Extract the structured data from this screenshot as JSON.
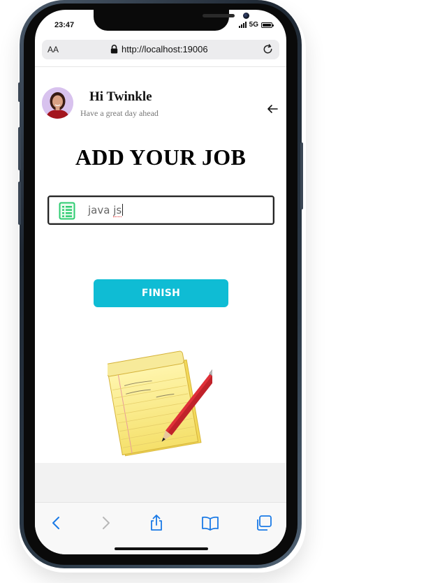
{
  "status_bar": {
    "time": "23:47",
    "network": "5G",
    "signal_icon": "cellular-signal-icon",
    "battery_icon": "battery-icon"
  },
  "browser": {
    "text_size_label": "AA",
    "url": "http://localhost:19006",
    "lock_icon": "lock-icon",
    "reload_icon": "reload-icon"
  },
  "header": {
    "greeting": "Hi Twinkle",
    "subtitle": "Have a great day ahead",
    "avatar_icon": "avatar",
    "back_icon": "arrow-left-icon"
  },
  "main": {
    "title": "ADD YOUR JOB",
    "job_input": {
      "value_part1": "java ",
      "value_part2": "js",
      "icon": "spreadsheet-icon"
    },
    "finish_label": "FINISH",
    "illustration": "notepad-pencil-illustration"
  },
  "toolbar": {
    "items": [
      "back-icon",
      "forward-icon",
      "share-icon",
      "bookmarks-icon",
      "tabs-icon"
    ]
  },
  "colors": {
    "accent": "#0fbcd4",
    "ios_blue": "#1a7ae6",
    "disabled": "#b8b8b8"
  }
}
